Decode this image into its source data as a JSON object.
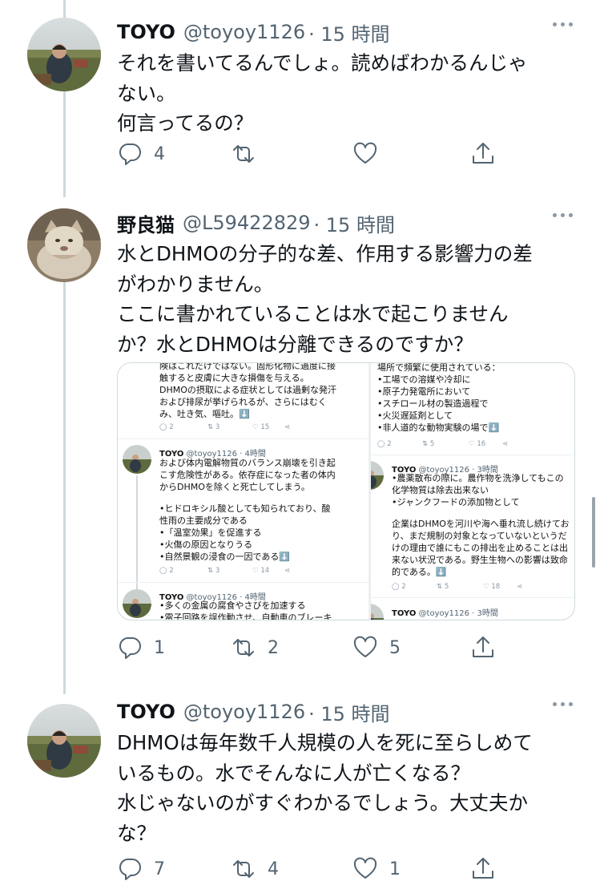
{
  "tweets": [
    {
      "name": "TOYO",
      "handle": "@toyoy1126",
      "time": "· 15 時間",
      "lines": [
        "それを書いてるんでしょ。読めばわかるんじゃ",
        "ない。",
        "何言ってるの？"
      ],
      "replies": "4",
      "retweets": "",
      "likes": ""
    },
    {
      "name": "野良猫",
      "handle": "@L59422829",
      "time": "· 15 時間",
      "lines": [
        "水とDHMOの分子的な差、作用する影響力の差",
        "がわかりません。",
        "ここに書かれていることは水で起こりません",
        "か？水とDHMOは分離できるのですか？"
      ],
      "replies": "1",
      "retweets": "2",
      "likes": "5"
    },
    {
      "name": "TOYO",
      "handle": "@toyoy1126",
      "time": "· 15 時間",
      "lines": [
        "DHMOは毎年数千人規模の人を死に至らしめて",
        "いるもの。水でそんなに人が亡くなる？",
        "水じゃないのがすぐわかるでしょう。大丈夫か",
        "な？"
      ],
      "replies": "7",
      "retweets": "4",
      "likes": "1"
    }
  ],
  "media": {
    "left": {
      "top_lines": [
        "険はこれだけではない。固形化物に過度に接",
        "触すると皮膚に大きな損傷を与える。",
        "DHMOの摂取による症状としては過剰な発汗",
        "および排尿が挙げられるが、さらにはむく",
        "み、吐き気、嘔吐。⬇️"
      ],
      "top_actions": [
        "2",
        "3",
        "15"
      ],
      "tweet2_name": "TOYO",
      "tweet2_meta": "@toyoy1126 · 4時間",
      "tweet2_lines": [
        "および体内電解物質のバランス崩壊を引き起",
        "こす危険性がある。依存症になった者の体内",
        "からDHMOを除くと死亡してしまう。",
        "",
        "•ヒドロキシル酸としても知られており、酸",
        "性雨の主要成分である",
        "•「温室効果」を促進する",
        "•火傷の原因となりうる",
        "•自然景観の浸食の一因である⬇️"
      ],
      "tweet2_actions": [
        "2",
        "3",
        "14"
      ],
      "tweet3_name": "TOYO",
      "tweet3_meta": "@toyoy1126 · 4時間",
      "tweet3_lines": [
        "•多くの金属の腐食やさびを加速する",
        "•電子回路を誤作動させ、自動車のブレーキ"
      ]
    },
    "right": {
      "top_lines": [
        "場所で頻繁に使用されている：",
        "•工場での溶媒や冷却に",
        "•原子力発電所において",
        "•スチロール材の製造過程で",
        "•火災遅延剤として",
        "•非人道的な動物実験の場で⬇️"
      ],
      "top_actions": [
        "2",
        "5",
        "16"
      ],
      "tweet2_name": "TOYO",
      "tweet2_meta": "@toyoy1126 · 3時間",
      "tweet2_lines": [
        "•農薬散布の際に。農作物を洗浄してもこの",
        "化学物質は除去出来ない",
        "•ジャンクフードの添加物として",
        "",
        "企業はDHMOを河川や海へ垂れ流し続けてお",
        "り、まだ規制の対象となっていないというだ",
        "けの理由で誰にもこの排出を止めることは出",
        "来ない状況である。野生生物への影響は致命",
        "的である。⬇️"
      ],
      "tweet2_actions": [
        "2",
        "5",
        "18"
      ],
      "tweet3_name": "TOYO",
      "tweet3_meta": "@toyoy1126 · 3時間"
    }
  },
  "icons": [
    "reply-icon",
    "retweet-icon",
    "like-icon",
    "share-icon",
    "more-icon"
  ]
}
